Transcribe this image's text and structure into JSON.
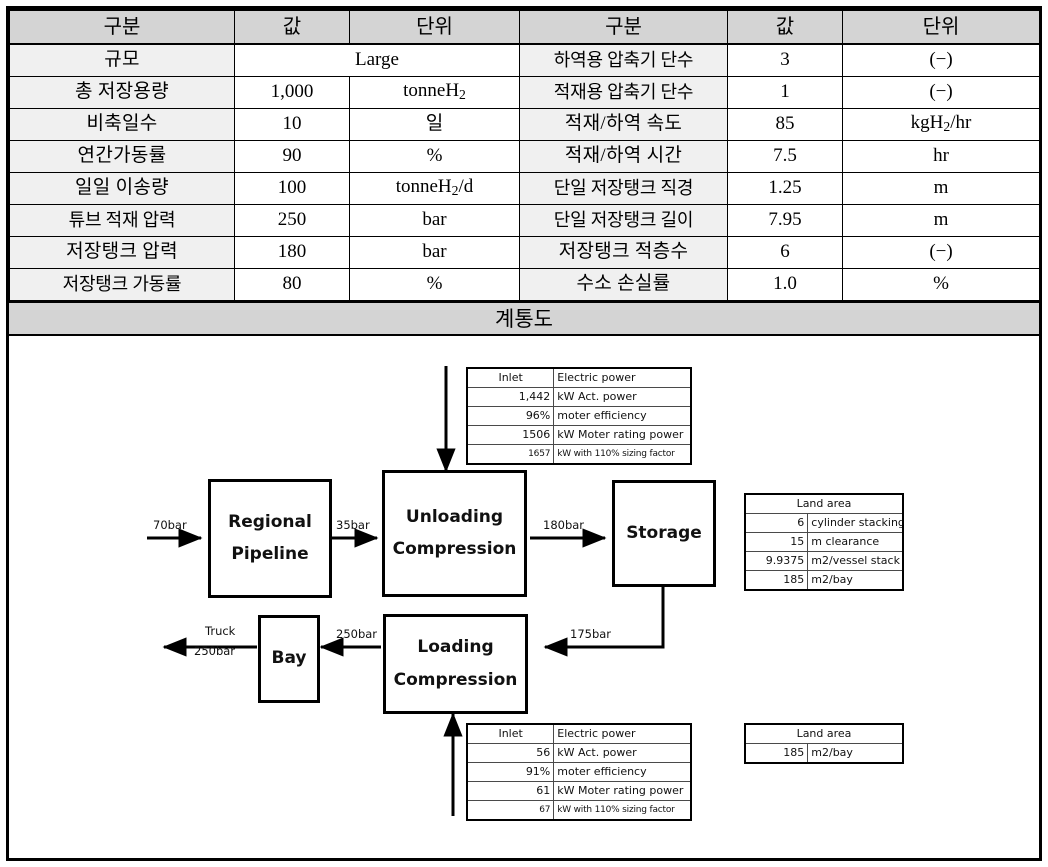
{
  "params_table": {
    "headers": [
      "구분",
      "값",
      "단위",
      "구분",
      "값",
      "단위"
    ],
    "rows": [
      {
        "left_label": "규모",
        "left_value": "Large",
        "left_value_span": true,
        "left_unit": "",
        "right_label": "하역용 압축기 단수",
        "right_value": "3",
        "right_unit": "(−)"
      },
      {
        "left_label": "총 저장용량",
        "left_value": "1,000",
        "left_unit": "tonneH2",
        "left_unit_sub": "2",
        "left_unit_pre": "tonneH",
        "left_unit_post": "",
        "right_label": "적재용 압축기 단수",
        "right_value": "1",
        "right_unit": "(−)"
      },
      {
        "left_label": "비축일수",
        "left_value": "10",
        "left_unit": "일",
        "right_label": "적재/하역 속도",
        "right_value": "85",
        "right_unit_pre": "kgH",
        "right_unit_sub": "2",
        "right_unit_post": "/hr"
      },
      {
        "left_label": "연간가동률",
        "left_value": "90",
        "left_unit": "%",
        "right_label": "적재/하역 시간",
        "right_value": "7.5",
        "right_unit": "hr"
      },
      {
        "left_label": "일일 이송량",
        "left_value": "100",
        "left_unit_pre": "tonneH",
        "left_unit_sub": "2",
        "left_unit_post": "/d",
        "right_label": "단일 저장탱크 직경",
        "right_value": "1.25",
        "right_unit": "m"
      },
      {
        "left_label": "튜브 적재 압력",
        "left_value": "250",
        "left_unit": "bar",
        "right_label": "단일 저장탱크 길이",
        "right_value": "7.95",
        "right_unit": "m"
      },
      {
        "left_label": "저장탱크 압력",
        "left_value": "180",
        "left_unit": "bar",
        "right_label": "저장탱크 적층수",
        "right_value": "6",
        "right_unit": "(−)"
      },
      {
        "left_label": "저장탱크 가동률",
        "left_value": "80",
        "left_unit": "%",
        "right_label": "수소 손실률",
        "right_value": "1.0",
        "right_unit": "%"
      }
    ]
  },
  "diagram": {
    "title": "계통도",
    "boxes": [
      {
        "id": "regional-pipeline",
        "line1": "Regional",
        "line2": "Pipeline"
      },
      {
        "id": "unloading-compression",
        "line1": "Unloading",
        "line2": "Compression"
      },
      {
        "id": "storage",
        "line1": "Storage",
        "line2": ""
      },
      {
        "id": "loading-compression",
        "line1": "Loading",
        "line2": "Compression"
      },
      {
        "id": "bay",
        "line1": "Bay",
        "line2": ""
      }
    ],
    "flow_labels": {
      "inlet_pipeline": "70bar",
      "pipeline_to_unloading": "35bar",
      "unloading_to_storage": "180bar",
      "storage_to_loading": "175bar",
      "loading_to_bay": "250bar",
      "bay_out_line1": "Truck",
      "bay_out_line2": "250bar"
    },
    "unloading_power_table": {
      "header_left": "Inlet",
      "header_right": "Electric power",
      "rows": [
        {
          "value": "1,442",
          "label": "kW Act. power",
          "small": false
        },
        {
          "value": "96%",
          "label": "moter efficiency",
          "small": false
        },
        {
          "value": "1506",
          "label": "kW Moter rating power",
          "small": false
        },
        {
          "value": "1657",
          "label": "kW with 110% sizing factor",
          "small": true
        }
      ]
    },
    "storage_land_table": {
      "header": "Land area",
      "rows": [
        {
          "value": "6",
          "label": "cylinder stacking"
        },
        {
          "value": "15",
          "label": "m clearance"
        },
        {
          "value": "9.9375",
          "label": "m2/vessel stack"
        },
        {
          "value": "185",
          "label": "m2/bay"
        }
      ]
    },
    "loading_power_table": {
      "header_left": "Inlet",
      "header_right": "Electric power",
      "rows": [
        {
          "value": "56",
          "label": "kW Act. power",
          "small": false
        },
        {
          "value": "91%",
          "label": "moter efficiency",
          "small": false
        },
        {
          "value": "61",
          "label": "kW Moter rating power",
          "small": false
        },
        {
          "value": "67",
          "label": "kW with 110% sizing factor",
          "small": true
        }
      ]
    },
    "bay_land_table": {
      "header": "Land area",
      "rows": [
        {
          "value": "185",
          "label": "m2/bay"
        }
      ]
    }
  },
  "colors": {
    "header_bg": "#d4d4d4",
    "label_bg": "#f0f0f0",
    "line": "#000000"
  }
}
